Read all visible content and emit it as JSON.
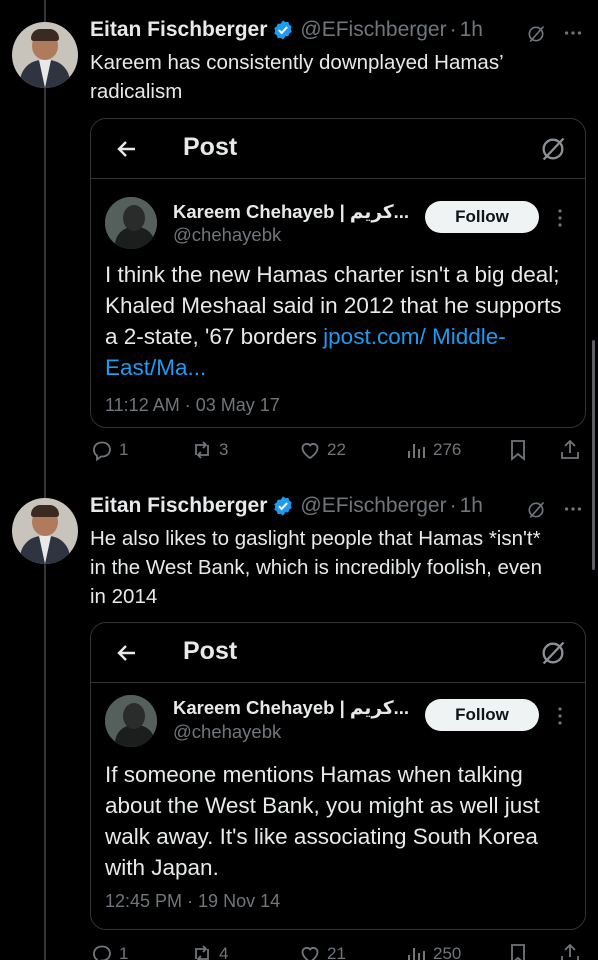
{
  "tweets": [
    {
      "author_name": "Eitan Fischberger",
      "author_handle": "@EFischberger",
      "time": "1h",
      "text": "Kareem has consistently downplayed Hamas’ radicalism",
      "quoted": {
        "header_title": "Post",
        "name": "Kareem Chehayeb | كريم...",
        "handle": "@chehayebk",
        "follow_label": "Follow",
        "text": "I think the new Hamas charter isn't a big deal; Khaled Meshaal said in 2012 that he supports a 2-state, '67 borders ",
        "link": "jpost.com/ Middle-East/Ma...",
        "timestamp": "11:12 AM · 03 May 17"
      },
      "stats": {
        "replies": "1",
        "reposts": "3",
        "likes": "22",
        "views": "276"
      }
    },
    {
      "author_name": "Eitan Fischberger",
      "author_handle": "@EFischberger",
      "time": "1h",
      "text": "He also likes to gaslight people that Hamas *isn't* in the West Bank, which is incredibly foolish, even in 2014",
      "quoted": {
        "header_title": "Post",
        "name": "Kareem Chehayeb | كريم...",
        "handle": "@chehayebk",
        "follow_label": "Follow",
        "text": "If someone mentions Hamas when talking about the West Bank, you might as well just walk away. It's like associating South Korea with Japan.",
        "link": "",
        "timestamp": "12:45 PM · 19 Nov 14"
      },
      "stats": {
        "replies": "1",
        "reposts": "4",
        "likes": "21",
        "views": "250"
      }
    }
  ],
  "separator": "·",
  "colors": {
    "background": "#000000",
    "text": "#e7e9ea",
    "muted": "#71767b",
    "link": "#1d9bf0",
    "verified": "#1d9bf0",
    "border": "#2f3336"
  },
  "icons": [
    "verified-badge-icon",
    "grok-icon",
    "more-icon",
    "back-arrow-icon",
    "reply-icon",
    "repost-icon",
    "like-icon",
    "views-icon",
    "bookmark-icon",
    "share-icon"
  ]
}
